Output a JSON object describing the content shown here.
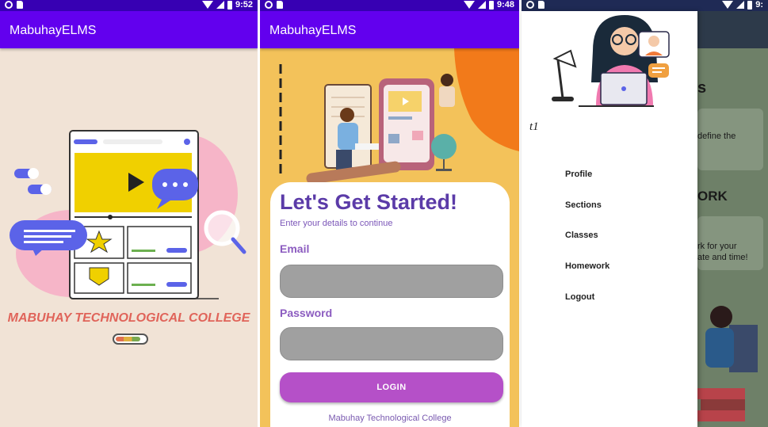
{
  "screens": [
    {
      "status": {
        "time": "9:52"
      },
      "appbar": {
        "title": "MabuhayELMS"
      },
      "splash": {
        "college_name": "MABUHAY TECHNOLOGICAL COLLEGE",
        "loading_progress": 0.85
      }
    },
    {
      "status": {
        "time": "9:48"
      },
      "appbar": {
        "title": "MabuhayELMS"
      },
      "login": {
        "title": "Let's Get Started!",
        "subtitle": "Enter your details to continue",
        "email_label": "Email",
        "email_value": "",
        "password_label": "Password",
        "password_value": "",
        "button_label": "LOGIN",
        "footer": "Mabuhay Technological College"
      }
    },
    {
      "status": {
        "time": "9:"
      },
      "drawer": {
        "header_label": "t1",
        "items": [
          "Profile",
          "Sections",
          "Classes",
          "Homework",
          "Logout"
        ]
      },
      "background": {
        "heading1": "s",
        "text1": "define the",
        "heading2": "ORK",
        "text2a": "rk for your",
        "text2b": "ate and time!"
      }
    }
  ],
  "colors": {
    "appbar": "#6200ee",
    "splash_bg": "#f1e3d6",
    "splash_text": "#e0645a",
    "login_bg": "#f3c25a",
    "login_title": "#5b3ba8",
    "login_button": "#b550c8",
    "input_fill": "#a0a0a0"
  }
}
